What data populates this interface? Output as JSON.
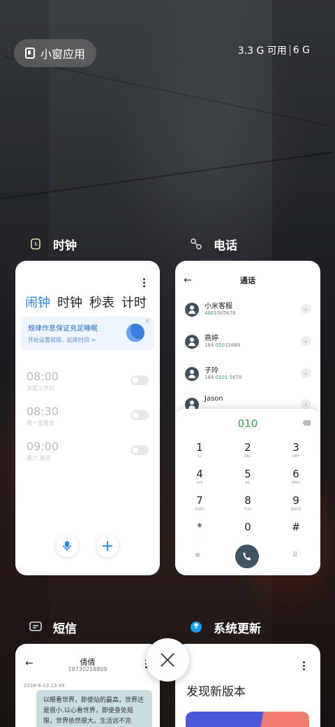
{
  "top_bar": {
    "float_window_label": "小窗应用",
    "memory_available": "3.3 G 可用",
    "memory_total": "6 G"
  },
  "apps": {
    "clock": {
      "label": "时钟",
      "tabs": [
        "闹钟",
        "时钟",
        "秒表",
        "计时"
      ],
      "banner_title": "规律作息保证充足睡眠",
      "banner_subtitle": "开始设置就寝、起床时间 >",
      "banner_close": "✕",
      "alarms": [
        {
          "time": "08:00",
          "label": "法定工作日"
        },
        {
          "time": "08:30",
          "label": "周一至周五"
        },
        {
          "time": "09:00",
          "label": "周六 周日"
        }
      ],
      "mic_icon": "microphone-icon",
      "add_label": "+"
    },
    "phone": {
      "label": "电话",
      "title": "通话",
      "contacts": [
        {
          "name": "小米客服",
          "number_hl": "400",
          "number_rest": "1005678"
        },
        {
          "name": "燕婷",
          "number_pre": "184 ",
          "number_hl": "010",
          "number_rest": "15689"
        },
        {
          "name": "子玲",
          "number_pre": "184 ",
          "number_hl": "0101",
          "number_rest": " 5678"
        },
        {
          "name": "Jason"
        }
      ],
      "dial_entry": "010",
      "keys": [
        {
          "d": "1",
          "l": "ω"
        },
        {
          "d": "2",
          "l": "ABC"
        },
        {
          "d": "3",
          "l": "DEF"
        },
        {
          "d": "4",
          "l": "GHI"
        },
        {
          "d": "5",
          "l": "JKL"
        },
        {
          "d": "6",
          "l": "MNO"
        },
        {
          "d": "7",
          "l": "PQRS"
        },
        {
          "d": "8",
          "l": "TUV"
        },
        {
          "d": "9",
          "l": "WXYZ"
        },
        {
          "d": "*",
          "l": ","
        },
        {
          "d": "0",
          "l": "+"
        },
        {
          "d": "#",
          "l": ""
        }
      ]
    },
    "sms": {
      "label": "短信",
      "contact_name": "倩倩",
      "contact_number": "18730218809",
      "date": "2016-6-13 13:49",
      "message": "以眼看世界，即使站的最高，世界还是很小.以心看世界，即使身处局限，世界依然很大。生活远不完"
    },
    "update": {
      "label": "系统更新",
      "heading": "发现新版本"
    }
  },
  "colors": {
    "accent_blue": "#1e88e5",
    "dial_green": "#2f9e57",
    "call_button": "#3f5563"
  }
}
